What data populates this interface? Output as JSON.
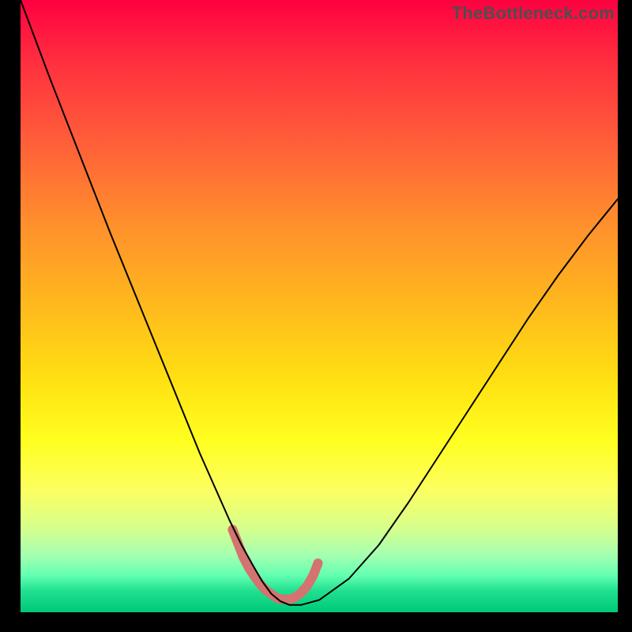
{
  "watermark": "TheBottleneck.com",
  "chart_data": {
    "type": "line",
    "title": "",
    "xlabel": "",
    "ylabel": "",
    "xlim": [
      0,
      100
    ],
    "ylim": [
      0,
      100
    ],
    "grid": false,
    "legend": false,
    "series": [
      {
        "name": "bottleneck-curve",
        "x": [
          0,
          5,
          10,
          15,
          20,
          25,
          30,
          32.5,
          35,
          37,
          39,
          40.5,
          42,
          43.5,
          45,
          47,
          50,
          55,
          60,
          65,
          70,
          75,
          80,
          85,
          90,
          95,
          100
        ],
        "y": [
          100,
          87,
          74.5,
          62,
          50,
          38,
          26,
          20.5,
          15,
          11,
          7.5,
          5,
          3,
          1.8,
          1.2,
          1.2,
          2,
          5.5,
          11,
          18,
          25.5,
          33,
          40.5,
          48,
          55,
          61.5,
          67.5
        ],
        "stroke": "#000000",
        "stroke_width": 2
      },
      {
        "name": "optimal-zone-marker",
        "x": [
          35.5,
          36.5,
          37.3,
          38.2,
          39.2,
          40.2,
          41.2,
          42.2,
          43,
          43.8,
          44.6,
          45.4,
          46.2,
          47,
          48,
          49,
          49.8
        ],
        "y": [
          13.5,
          11,
          9,
          7.3,
          5.8,
          4.5,
          3.5,
          2.8,
          2.3,
          2.1,
          2.1,
          2.2,
          2.6,
          3.2,
          4.3,
          6,
          8
        ],
        "stroke": "#d4736f",
        "stroke_width": 12,
        "linecap": "round"
      }
    ],
    "background_gradient": [
      {
        "stop": 0,
        "color": "#ff0040"
      },
      {
        "stop": 0.35,
        "color": "#ff8a2e"
      },
      {
        "stop": 0.72,
        "color": "#ffff20"
      },
      {
        "stop": 1.0,
        "color": "#00c878"
      }
    ]
  }
}
